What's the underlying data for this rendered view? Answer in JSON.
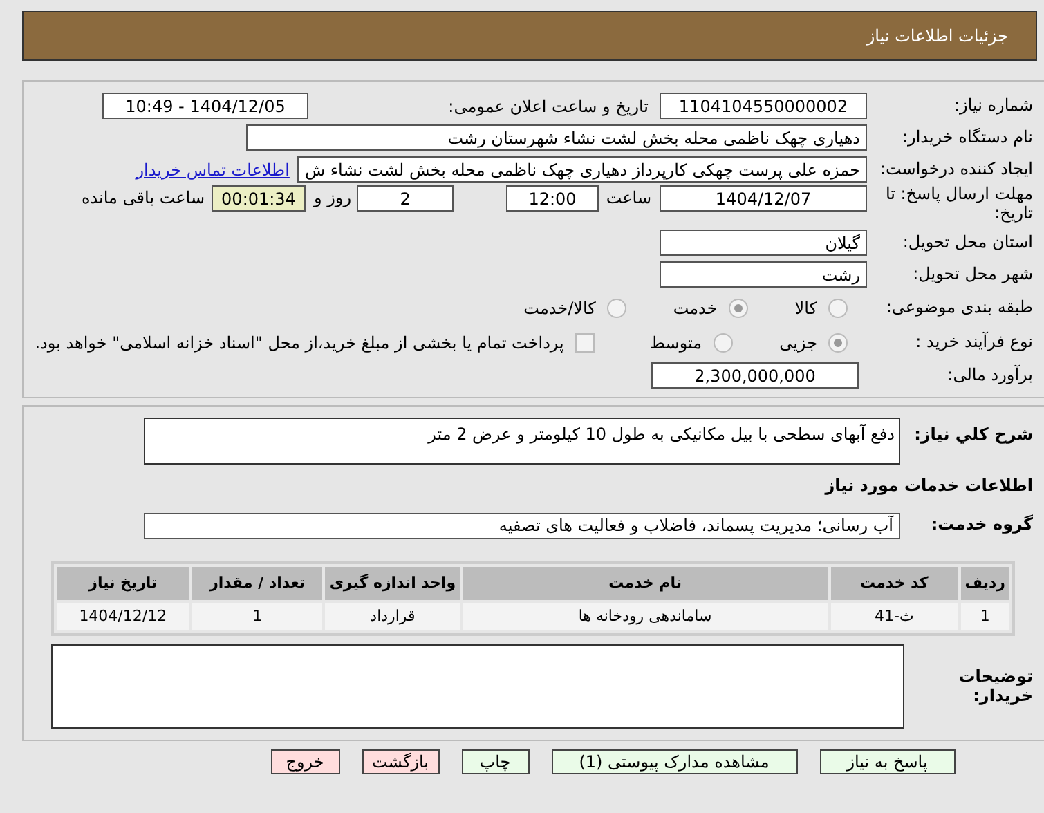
{
  "page_title": "جزئیات اطلاعات نیاز",
  "need_number": {
    "label": "شماره نیاز:",
    "value": "1104104550000002"
  },
  "announce_date": {
    "label": "تاریخ و ساعت اعلان عمومی:",
    "value": "1404/12/05 - 10:49"
  },
  "buyer_org": {
    "label": "نام دستگاه خریدار:",
    "value": "دهیاری چهک ناظمی محله بخش لشت نشاء شهرستان رشت"
  },
  "requester": {
    "label": "ایجاد کننده درخواست:",
    "value": "حمزه علی پرست چهکی کارپرداز دهیاری چهک ناظمی محله بخش لشت نشاء ش",
    "link": "اطلاعات تماس خریدار"
  },
  "deadline": {
    "label": "مهلت ارسال پاسخ: تا تاریخ:",
    "date": "1404/12/07",
    "time_label": "ساعت",
    "time": "12:00",
    "days": "2",
    "days_label": "روز و",
    "remaining": "00:01:34",
    "remaining_label": "ساعت باقی مانده"
  },
  "province": {
    "label": "استان محل تحویل:",
    "value": "گیلان"
  },
  "city": {
    "label": "شهر محل تحویل:",
    "value": "رشت"
  },
  "category": {
    "label": "طبقه بندی موضوعی:",
    "options": [
      {
        "label": "کالا",
        "selected": false
      },
      {
        "label": "خدمت",
        "selected": true
      },
      {
        "label": "کالا/خدمت",
        "selected": false
      }
    ]
  },
  "purchase_type": {
    "label": "نوع فرآیند خرید :",
    "options": [
      {
        "label": "جزیی",
        "selected": true
      },
      {
        "label": "متوسط",
        "selected": false
      }
    ],
    "treasury": {
      "label": "پرداخت تمام یا بخشی از مبلغ خرید،از محل \"اسناد خزانه اسلامی\" خواهد بود.",
      "checked": false
    }
  },
  "budget": {
    "label": "برآورد مالی:",
    "value": "2,300,000,000"
  },
  "description": {
    "label": "شرح کلي نياز:",
    "value": "دفع آبهای سطحی با بیل مکانیکی به طول 10 کیلومتر و عرض 2 متر"
  },
  "services_heading": "اطلاعات خدمات مورد نیاز",
  "service_group": {
    "label": "گروه خدمت:",
    "value": "آب رسانی؛ مدیریت پسماند، فاضلاب و فعالیت های تصفیه"
  },
  "table": {
    "columns": [
      "ردیف",
      "کد خدمت",
      "نام خدمت",
      "واحد اندازه گیری",
      "تعداد / مقدار",
      "تاریخ نیاز"
    ],
    "rows": [
      [
        "1",
        "ث-41",
        "ساماندهی رودخانه ها",
        "قرارداد",
        "1",
        "1404/12/12"
      ]
    ]
  },
  "buyer_notes": {
    "label": "توضیحات خریدار:"
  },
  "buttons": [
    {
      "label": "پاسخ به نیاز",
      "kind": "normal"
    },
    {
      "label": "مشاهده مدارک پیوستی (1)",
      "kind": "normal"
    },
    {
      "label": "چاپ",
      "kind": "normal"
    },
    {
      "label": "بازگشت",
      "kind": "exit"
    },
    {
      "label": "خروج",
      "kind": "exit"
    }
  ]
}
